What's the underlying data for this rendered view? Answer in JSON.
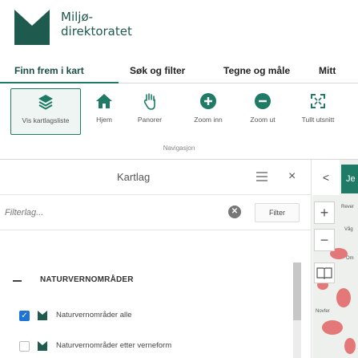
{
  "header": {
    "logo_line1": "Miljø-",
    "logo_line2": "direktoratet",
    "brand_color": "#1f5a4e",
    "accent_color": "#1f7a66"
  },
  "tabs": [
    {
      "label": "Finn frem i kart",
      "active": true
    },
    {
      "label": "Søk og filter"
    },
    {
      "label": "Tegne og måle"
    },
    {
      "label": "Mitt"
    }
  ],
  "toolbar": {
    "tools": [
      {
        "label": "Vis kartlagsliste",
        "icon": "layers-icon",
        "active": true
      },
      {
        "label": "Hjem",
        "icon": "home-icon"
      },
      {
        "label": "Panorer",
        "icon": "hand-icon"
      },
      {
        "label": "Zoom inn",
        "icon": "zoom-in-icon"
      },
      {
        "label": "Zoom ut",
        "icon": "zoom-out-icon"
      },
      {
        "label": "Tullt utsnitt",
        "icon": "full-extent-icon"
      }
    ],
    "group_label": "Navigasjon"
  },
  "layer_panel": {
    "title": "Kartlag",
    "filter_placeholder": "Filterlag...",
    "clear_label": "✕",
    "filter_button": "Filter",
    "group": {
      "label": "NATURVERNOMRÅDER",
      "layers": [
        {
          "label": "Naturvernområder alle",
          "checked": true
        },
        {
          "label": "Naturvernområder etter verneform",
          "checked": false
        }
      ]
    }
  },
  "map": {
    "back_label": "<",
    "side_button_label": "Je",
    "zoom_in": "+",
    "zoom_out": "−",
    "labels": [
      "Rever",
      "Våg",
      "Novfer",
      "Om"
    ]
  }
}
